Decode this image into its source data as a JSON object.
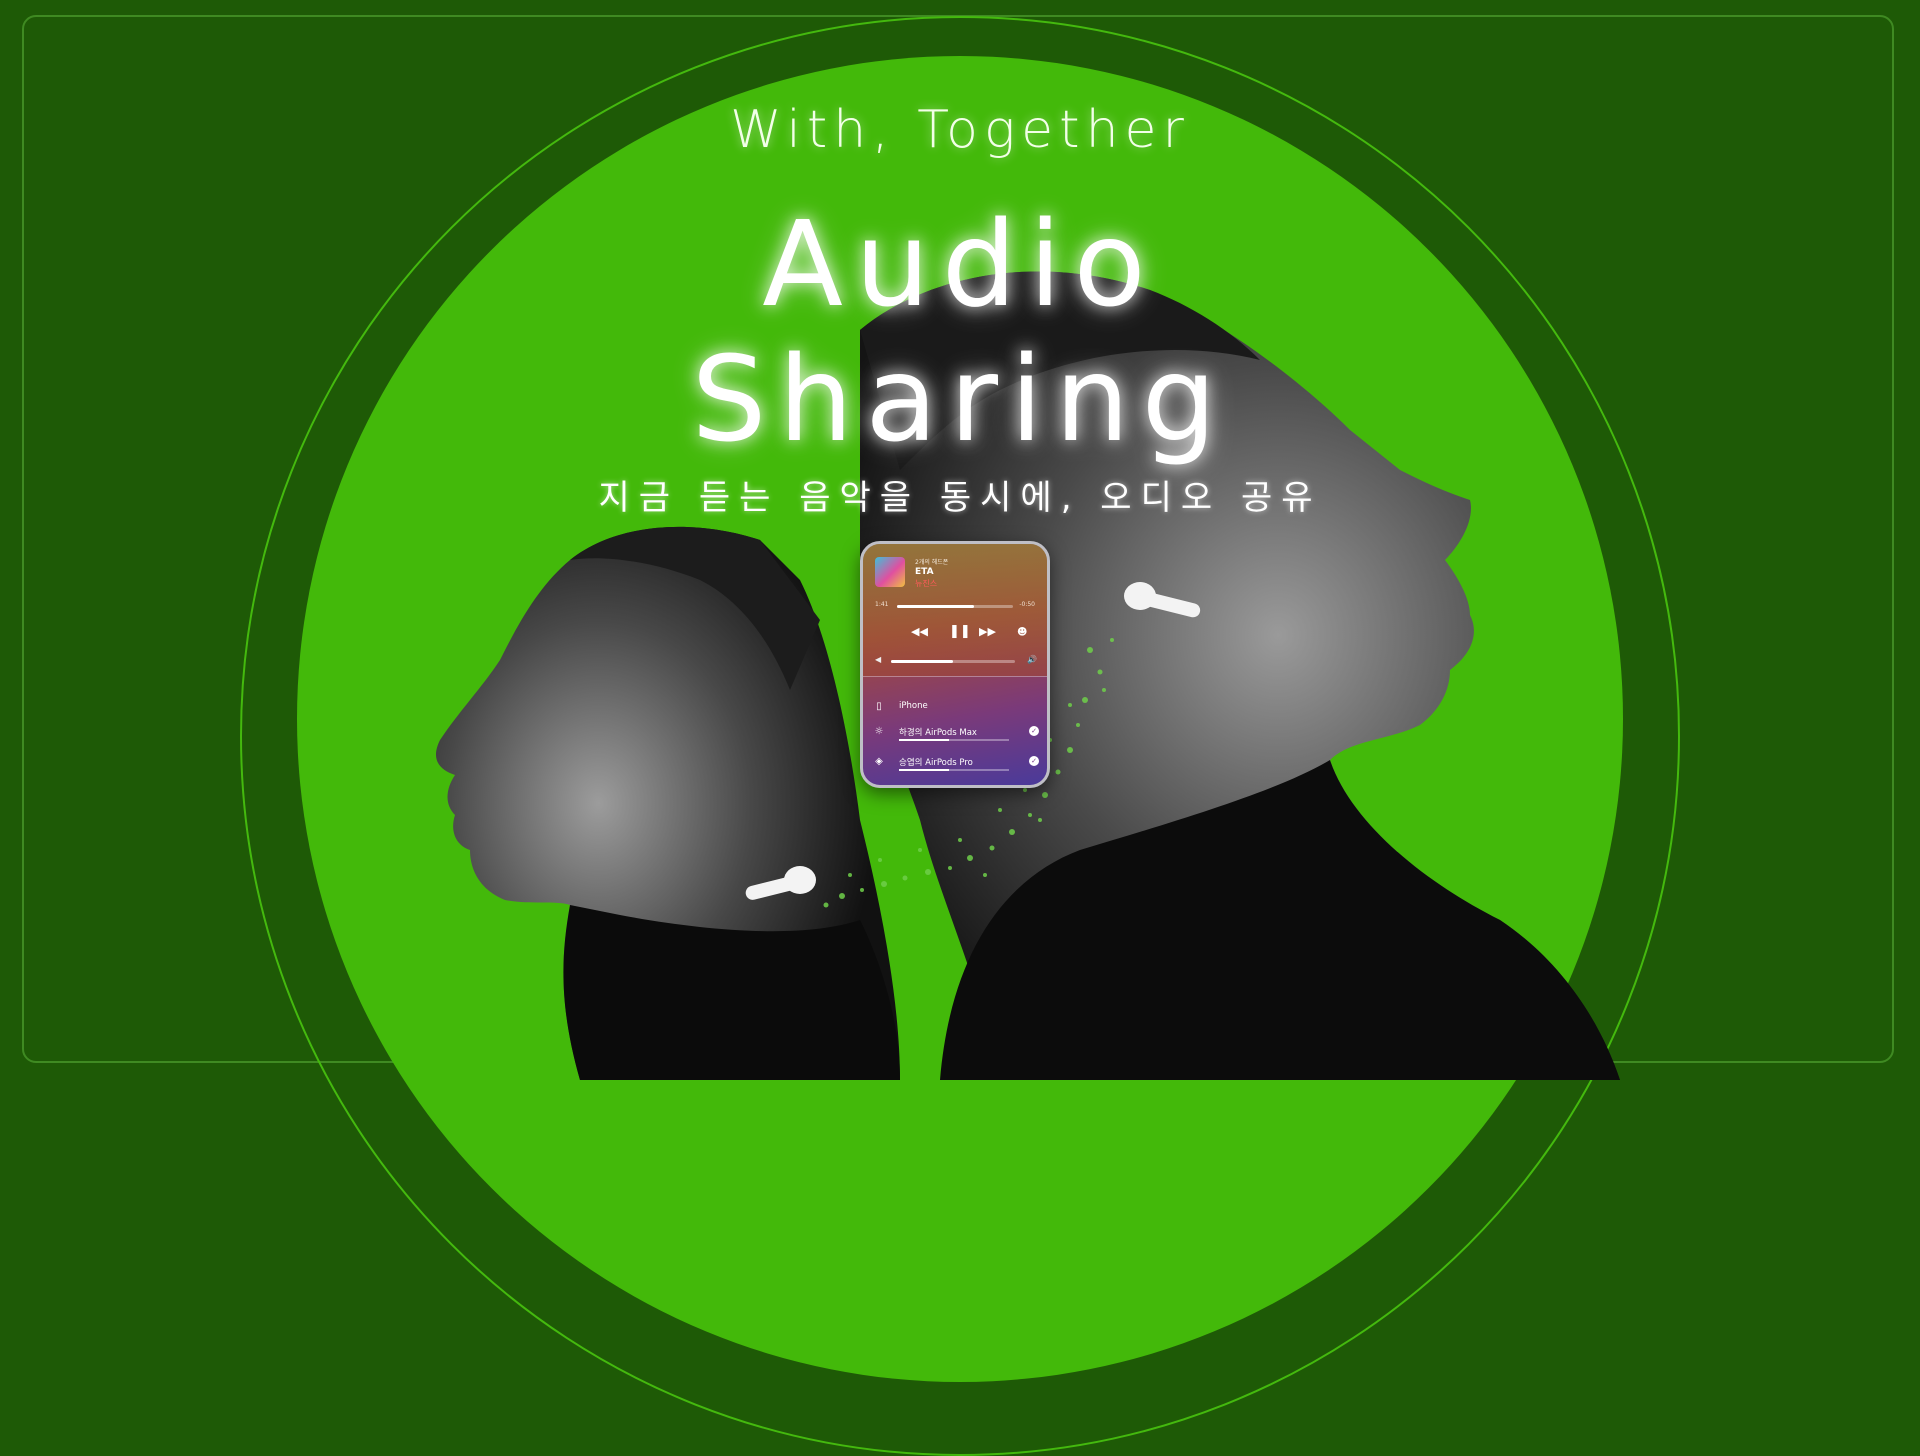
{
  "banner": {
    "tagline": "With, Together",
    "title_line1": "Audio",
    "title_line2": "Sharing",
    "subtitle": "지금 듣는 음악을 동시에, 오디오 공유"
  },
  "player": {
    "album": "2개의 헤드폰",
    "song": "ETA",
    "artist": "뉴진스",
    "time_elapsed": "1:41",
    "time_remaining": "-0:50",
    "progress": 0.66,
    "volume": 0.5,
    "controls": {
      "rewind": "◀◀",
      "pause": "❚❚",
      "forward": "▶▶"
    }
  },
  "devices": [
    {
      "name": "iPhone",
      "icon": "iphone-icon",
      "checked": false
    },
    {
      "name": "하경의 AirPods Max",
      "icon": "headphones-icon",
      "checked": true,
      "volume": 0.45
    },
    {
      "name": "승엽의 AirPods Pro",
      "icon": "airpods-icon",
      "checked": true,
      "volume": 0.45
    }
  ],
  "colors": {
    "background": "#1e5a06",
    "disk": "#43b90a",
    "ring": "#44b90e",
    "frame": "#3f8a22"
  }
}
